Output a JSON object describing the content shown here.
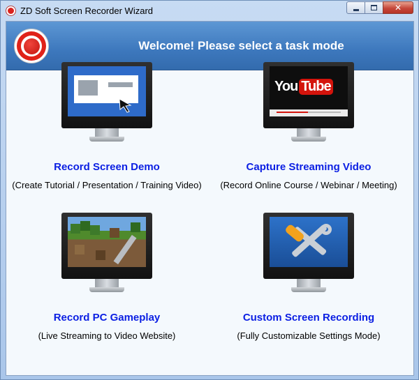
{
  "window": {
    "title": "ZD Soft Screen Recorder Wizard",
    "controls": {
      "minimize": "minimize",
      "maximize": "maximize",
      "close": "✕"
    }
  },
  "banner": {
    "heading": "Welcome! Please select a task mode",
    "icon": "record-icon"
  },
  "tasks": [
    {
      "title": "Record Screen Demo",
      "subtitle": "(Create Tutorial / Presentation / Training Video)",
      "icon": "screen-demo-monitor-icon"
    },
    {
      "title": "Capture Streaming Video",
      "subtitle": "(Record Online Course / Webinar / Meeting)",
      "icon": "streaming-video-monitor-icon",
      "screen_logo": {
        "you": "You",
        "tube": "Tube"
      }
    },
    {
      "title": "Record PC Gameplay",
      "subtitle": "(Live Streaming to Video Website)",
      "icon": "gameplay-monitor-icon"
    },
    {
      "title": "Custom Screen Recording",
      "subtitle": "(Fully Customizable Settings Mode)",
      "icon": "tools-monitor-icon"
    }
  ],
  "colors": {
    "banner": "#3d78bd",
    "task_title": "#0b1fe3",
    "record_red": "#e02219",
    "youtube_red": "#d4140c"
  }
}
